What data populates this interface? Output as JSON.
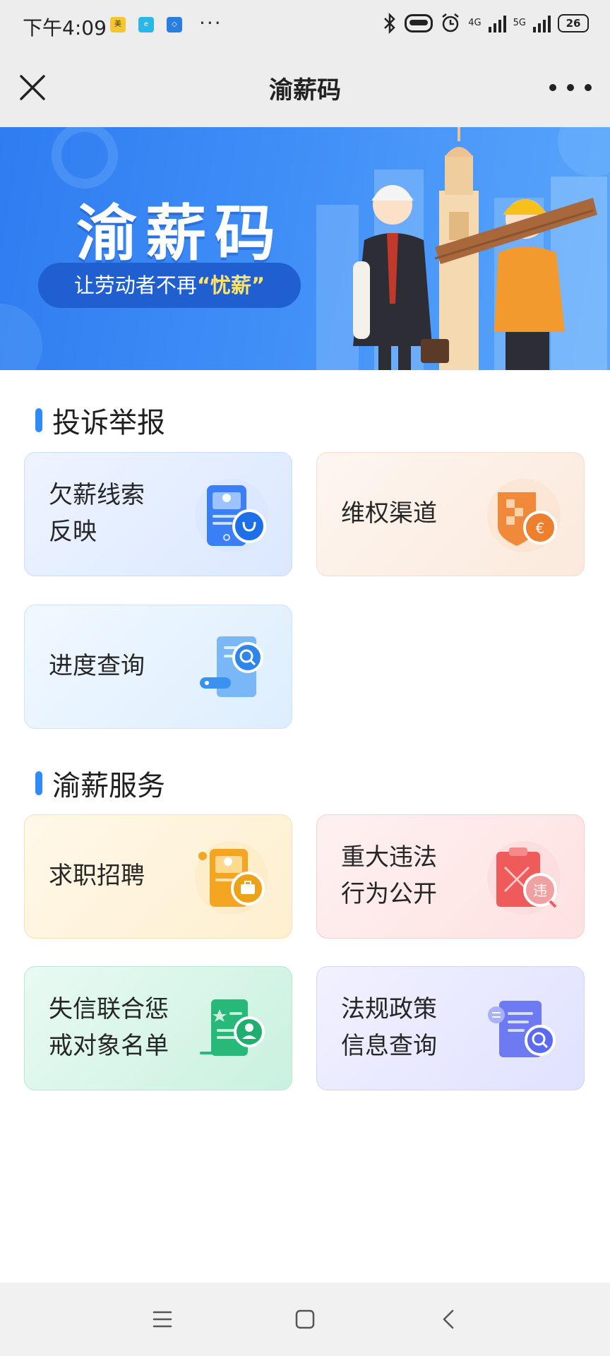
{
  "status_bar": {
    "time": "下午4:09",
    "app_icons": [
      "meituan-icon",
      "e-icon",
      "blue-app-icon"
    ],
    "more": "···",
    "network_4g": "4G",
    "network_5g": "5G",
    "battery": "26"
  },
  "nav": {
    "title": "渝薪码",
    "close_icon": "close-icon",
    "more_icon": "more-icon"
  },
  "banner": {
    "title": "渝薪码",
    "slogan_prefix": "让劳动者不再",
    "slogan_highlight": "“忧薪”"
  },
  "sections": [
    {
      "title": "投诉举报",
      "cards": [
        {
          "label": "欠薪线索\n反映",
          "icon": "phone-user-icon",
          "color": "#3a7ff6"
        },
        {
          "label": "维权渠道",
          "icon": "shield-currency-icon",
          "color": "#f08a3a"
        },
        {
          "label": "进度查询",
          "icon": "document-search-icon",
          "color": "#3a92f0"
        }
      ]
    },
    {
      "title": "渝薪服务",
      "cards": [
        {
          "label": "求职招聘",
          "icon": "resume-briefcase-icon",
          "color": "#f4a623"
        },
        {
          "label": "重大违法\n行为公开",
          "icon": "violation-clipboard-icon",
          "color": "#ef5a5a"
        },
        {
          "label": "失信联合惩\n戒对象名单",
          "icon": "list-user-icon",
          "color": "#27b97a"
        },
        {
          "label": "法规政策\n信息查询",
          "icon": "policy-search-icon",
          "color": "#5b6af0"
        }
      ]
    }
  ],
  "bottom_nav": {
    "menu_icon": "menu-icon",
    "home_icon": "home-square-icon",
    "back_icon": "back-chevron-icon"
  }
}
